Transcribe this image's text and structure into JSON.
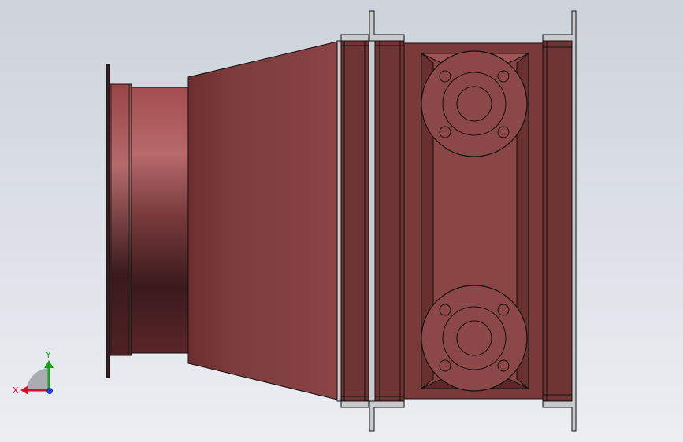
{
  "triad": {
    "x_label": "X",
    "y_label": "Y",
    "x_color": "#d0102a",
    "y_color": "#18a01e",
    "z_color": "#1a3ad8"
  },
  "model": {
    "body_color": "#85423f",
    "shadow_color": "#3a1c1e",
    "outline_color": "#111111",
    "flange_color": "#c8cace"
  }
}
